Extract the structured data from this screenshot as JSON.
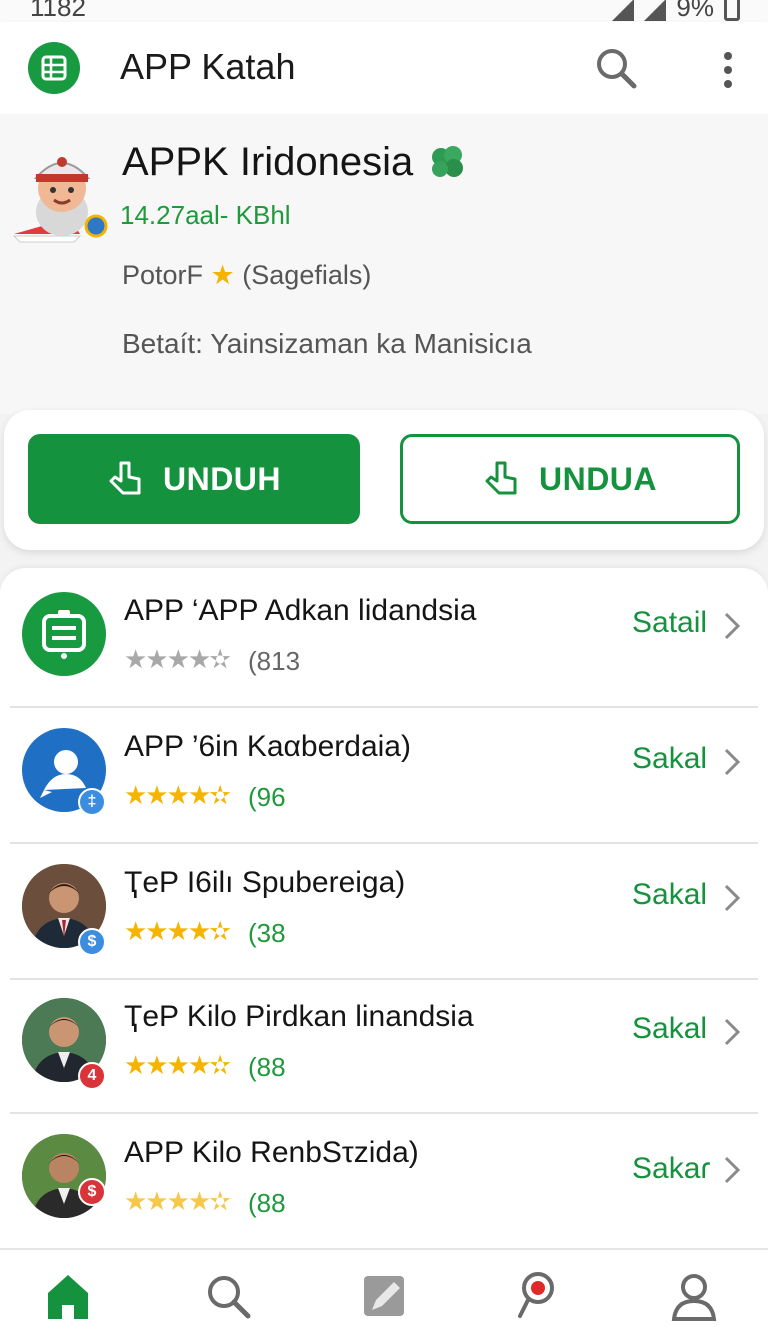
{
  "status_bar": {
    "time": "1182",
    "battery": "9%"
  },
  "app_bar": {
    "title": "APP Katah"
  },
  "hero": {
    "title": "APPK Iridonesia",
    "size": "14.27aal- KBhl",
    "rating_prefix": "PotorF",
    "rating_suffix": "(Sagefials)",
    "description": "Betaít: Yainsizaman ka Manisicıa"
  },
  "buttons": {
    "primary_label": "UNDUH",
    "secondary_label": "UNDUA"
  },
  "list": {
    "items": [
      {
        "title": "APP ‘APP Adkan lidandsia",
        "stars": "★★★★✫",
        "count": "(813",
        "action": "Satail",
        "badge": ""
      },
      {
        "title": "APP ’6in Kaαberdaia)",
        "stars": "★★★★✫",
        "count": "(96",
        "action": "Sakal",
        "badge": "‡"
      },
      {
        "title": "ҬeP I6ilı Spubereiga)",
        "stars": "★★★★✫",
        "count": "(38",
        "action": "Sakal",
        "badge": "$"
      },
      {
        "title": "ҬeP Kilo Pirdkan linandsia",
        "stars": "★★★★✫",
        "count": "(88",
        "action": "Sakal",
        "badge": "4"
      },
      {
        "title": "APP Kilo RenbSτzida)",
        "stars": "★★★★✫",
        "count": "(88",
        "action": "Sakaɾ",
        "badge": "$"
      }
    ]
  },
  "colors": {
    "primary": "#15923e",
    "star": "#f4b400"
  }
}
